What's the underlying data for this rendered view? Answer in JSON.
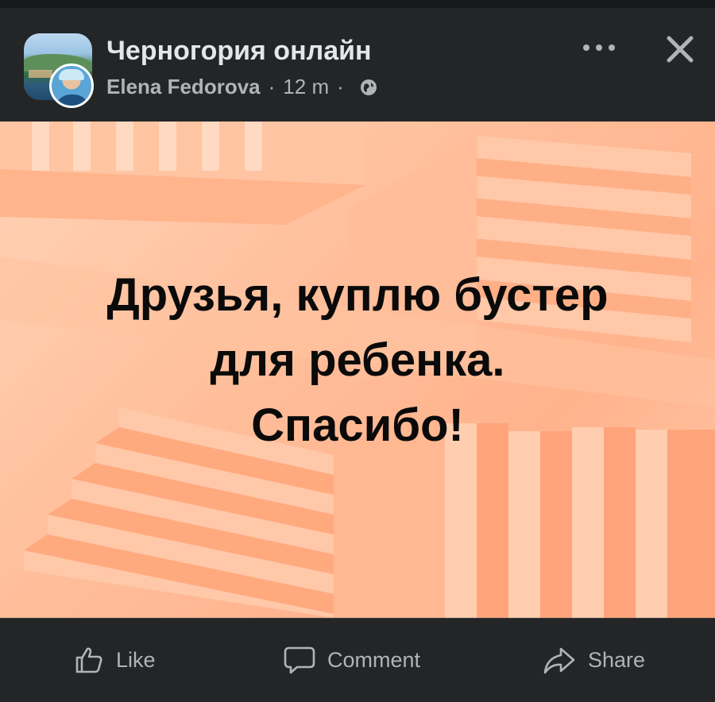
{
  "header": {
    "group_name": "Черногория онлайн",
    "author": "Elena Fedorova",
    "time": "12 m",
    "separator": "·",
    "privacy_icon": "globe-icon",
    "more_icon": "more-icon",
    "close_icon": "close-icon"
  },
  "post": {
    "lines": [
      "Друзья, куплю бустер",
      "для ребенка.",
      "Спасибо!"
    ],
    "background_color": "#ffbc98",
    "text_color": "#0a0a0a"
  },
  "actions": {
    "like": {
      "label": "Like",
      "icon": "thumbs-up-icon"
    },
    "comment": {
      "label": "Comment",
      "icon": "speech-bubble-icon"
    },
    "share": {
      "label": "Share",
      "icon": "share-arrow-icon"
    }
  },
  "colors": {
    "background": "#242526",
    "primary_text": "#e4e6eb",
    "secondary_text": "#b0b3b8"
  }
}
